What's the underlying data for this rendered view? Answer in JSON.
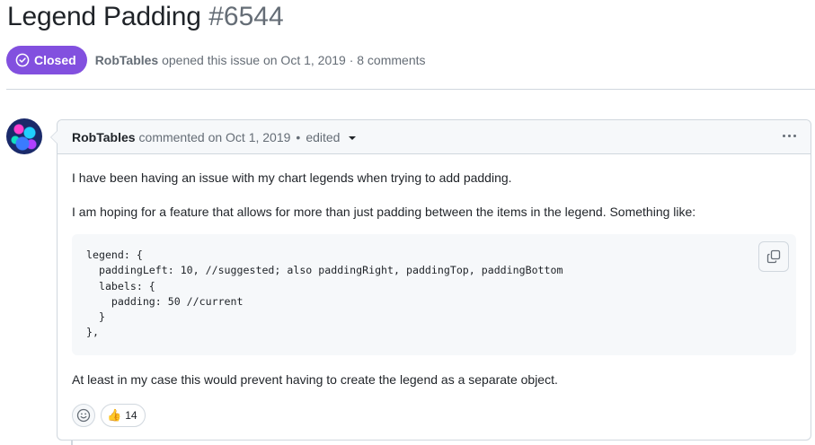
{
  "issue": {
    "title": "Legend Padding",
    "number": "#6544",
    "state": "Closed",
    "author": "RobTables",
    "opened_text": "opened this issue on Oct 1, 2019 · 8 comments"
  },
  "comment": {
    "author": "RobTables",
    "commented_text": "commented on Oct 1, 2019",
    "separator": "•",
    "edited_label": "edited",
    "paragraphs": [
      "I have been having an issue with my chart legends when trying to add padding.",
      "I am hoping for a feature that allows for more than just padding between the items in the legend. Something like:",
      "At least in my case this would prevent having to create the legend as a separate object."
    ],
    "code": "legend: {\n  paddingLeft: 10, //suggested; also paddingRight, paddingTop, paddingBottom\n  labels: {\n    padding: 50 //current\n  }\n},",
    "reactions": [
      {
        "emoji": "👍",
        "icon": "thumbs-up-icon",
        "count": "14"
      }
    ]
  },
  "colors": {
    "closed_badge": "#8250df",
    "text_primary": "#1f2328",
    "text_muted": "#656d76",
    "border": "#d0d7de",
    "header_bg": "#f6f8fa"
  }
}
